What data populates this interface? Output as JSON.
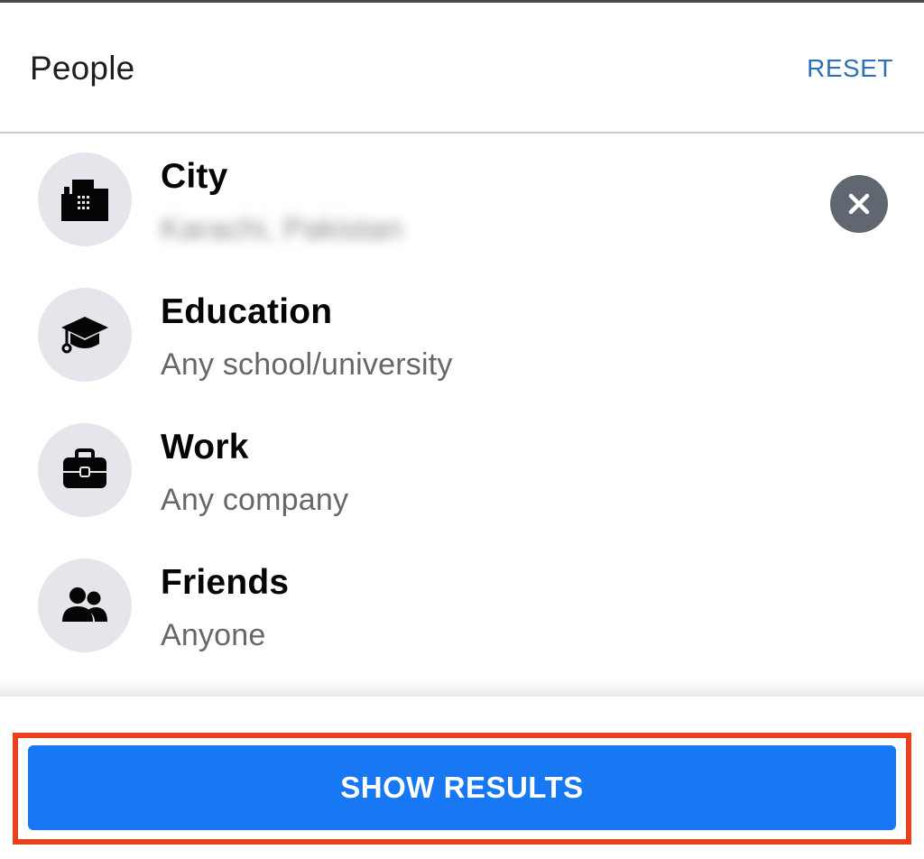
{
  "header": {
    "title": "People",
    "reset_label": "RESET"
  },
  "filters": [
    {
      "title": "City",
      "value": "Karachi, Pakistan",
      "icon": "building-icon",
      "clearable": true
    },
    {
      "title": "Education",
      "value": "Any school/university",
      "icon": "graduation-cap-icon"
    },
    {
      "title": "Work",
      "value": "Any company",
      "icon": "briefcase-icon"
    },
    {
      "title": "Friends",
      "value": "Anyone",
      "icon": "people-icon"
    }
  ],
  "footer": {
    "show_results_label": "SHOW RESULTS"
  },
  "colors": {
    "accent": "#1877f2",
    "link": "#2d6fb8",
    "highlight": "#e8411b",
    "icon_bg": "#e4e6eb",
    "secondary_text": "#65676b"
  }
}
